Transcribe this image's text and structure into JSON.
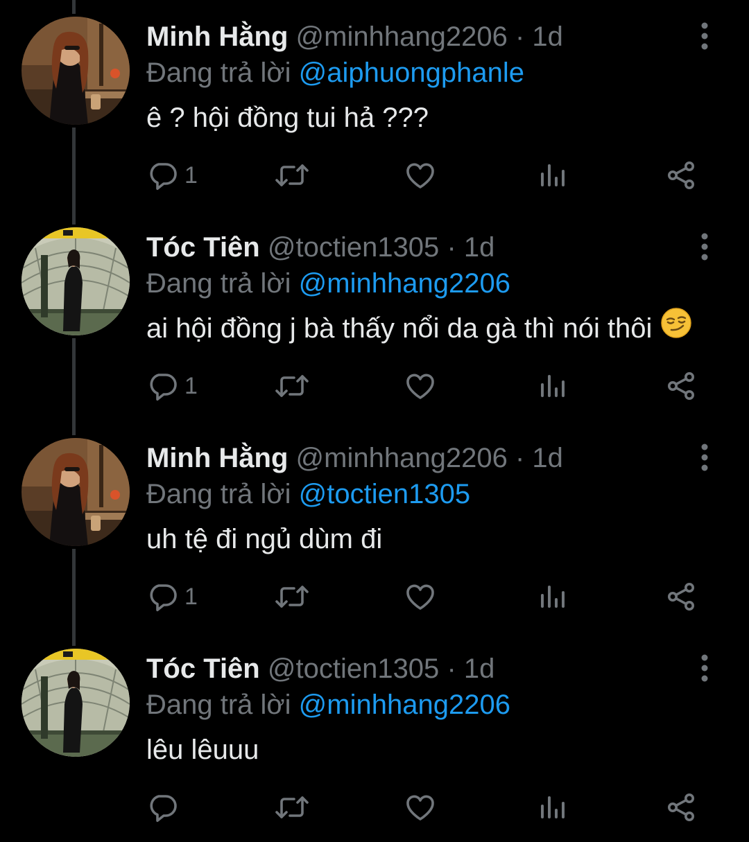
{
  "colors": {
    "background": "#000000",
    "primary_text": "#e7e9ea",
    "secondary_text": "#71767b",
    "link": "#1d9bf0",
    "thread_line": "#333639"
  },
  "tweets": [
    {
      "display_name": "Minh Hằng",
      "handle": "@minhhang2206",
      "separator": "·",
      "time": "1d",
      "reply_prefix": "Đang trả lời",
      "reply_to": "@aiphuongphanle",
      "text": "ê ? hội đồng tui hả ???",
      "reply_count": "1",
      "avatar_icon": "avatar-minh-hang"
    },
    {
      "display_name": "Tóc Tiên",
      "handle": "@toctien1305",
      "separator": "·",
      "time": "1d",
      "reply_prefix": "Đang trả lời",
      "reply_to": "@minhhang2206",
      "text": "ai hội đồng j bà thấy nổi da gà thì nói thôi",
      "emoji": "smirking-face-emoji",
      "reply_count": "1",
      "avatar_icon": "avatar-toc-tien"
    },
    {
      "display_name": "Minh Hằng",
      "handle": "@minhhang2206",
      "separator": "·",
      "time": "1d",
      "reply_prefix": "Đang trả lời",
      "reply_to": "@toctien1305",
      "text": "uh tệ đi ngủ dùm đi",
      "reply_count": "1",
      "avatar_icon": "avatar-minh-hang"
    },
    {
      "display_name": "Tóc Tiên",
      "handle": "@toctien1305",
      "separator": "·",
      "time": "1d",
      "reply_prefix": "Đang trả lời",
      "reply_to": "@minhhang2206",
      "text": "lêu lêuuu",
      "reply_count": "",
      "avatar_icon": "avatar-toc-tien"
    }
  ]
}
